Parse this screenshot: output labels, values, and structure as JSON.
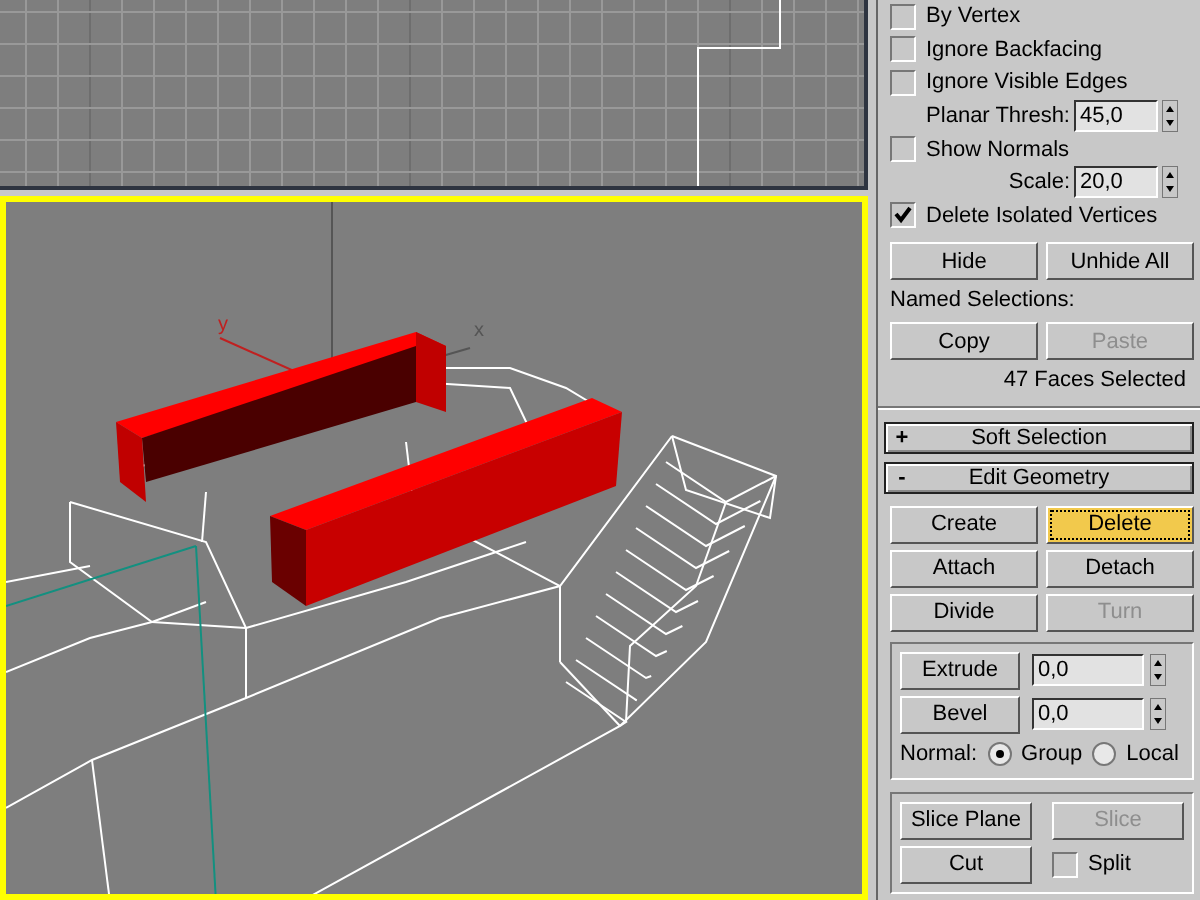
{
  "viewports": [
    {
      "kind": "grid",
      "active": false
    },
    {
      "kind": "perspective",
      "active": true,
      "axis_labels": [
        "y",
        "x"
      ]
    }
  ],
  "panel": {
    "options": [
      {
        "kind": "checkbox",
        "label": "By Vertex",
        "checked": false
      },
      {
        "kind": "checkbox",
        "label": "Ignore Backfacing",
        "checked": false
      },
      {
        "kind": "checkbox",
        "label": "Ignore Visible Edges",
        "checked": false
      },
      {
        "kind": "spinner",
        "label": "Planar Thresh:",
        "value": "45,0"
      },
      {
        "kind": "checkbox",
        "label": "Show Normals",
        "checked": false
      },
      {
        "kind": "spinner",
        "label": "Scale:",
        "value": "20,0"
      },
      {
        "kind": "checkbox",
        "label": "Delete Isolated Vertices",
        "checked": true
      }
    ],
    "selection_buttons": [
      {
        "label": "Hide",
        "disabled": false
      },
      {
        "label": "Unhide All",
        "disabled": false
      }
    ],
    "named_selections_label": "Named Selections:",
    "named_buttons": [
      {
        "label": "Copy",
        "disabled": false
      },
      {
        "label": "Paste",
        "disabled": true
      }
    ],
    "status": "47 Faces Selected",
    "rollouts": [
      {
        "sign": "+",
        "title": "Soft Selection"
      },
      {
        "sign": "-",
        "title": "Edit Geometry"
      }
    ],
    "geometry_buttons": [
      {
        "label": "Create",
        "disabled": false,
        "selected": false
      },
      {
        "label": "Delete",
        "disabled": false,
        "selected": true
      },
      {
        "label": "Attach",
        "disabled": false,
        "selected": false
      },
      {
        "label": "Detach",
        "disabled": false,
        "selected": false
      },
      {
        "label": "Divide",
        "disabled": false,
        "selected": false
      },
      {
        "label": "Turn",
        "disabled": true,
        "selected": false
      }
    ],
    "extrude_group": {
      "rows": [
        {
          "label": "Extrude",
          "value": "0,0"
        },
        {
          "label": "Bevel",
          "value": "0,0"
        }
      ],
      "normal_label": "Normal:",
      "normal_options": [
        {
          "label": "Group",
          "selected": true
        },
        {
          "label": "Local",
          "selected": false
        }
      ]
    },
    "slice_group": [
      {
        "kind": "button",
        "label": "Slice Plane",
        "disabled": false
      },
      {
        "kind": "button",
        "label": "Slice",
        "disabled": true
      },
      {
        "kind": "button",
        "label": "Cut",
        "disabled": false
      },
      {
        "kind": "checkbox",
        "label": "Split",
        "checked": false
      }
    ]
  }
}
